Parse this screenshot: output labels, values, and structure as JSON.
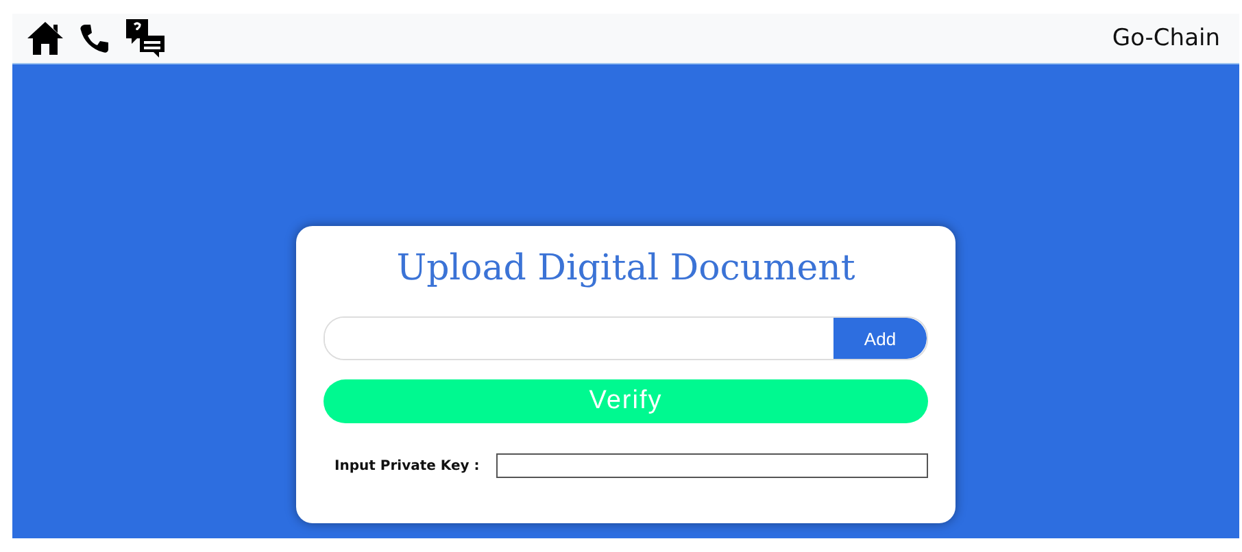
{
  "navbar": {
    "brand": "Go-Chain"
  },
  "card": {
    "title": "Upload Digital Document",
    "add_button": "Add",
    "verify_button": "Verify",
    "private_key_label": "Input Private Key :"
  }
}
